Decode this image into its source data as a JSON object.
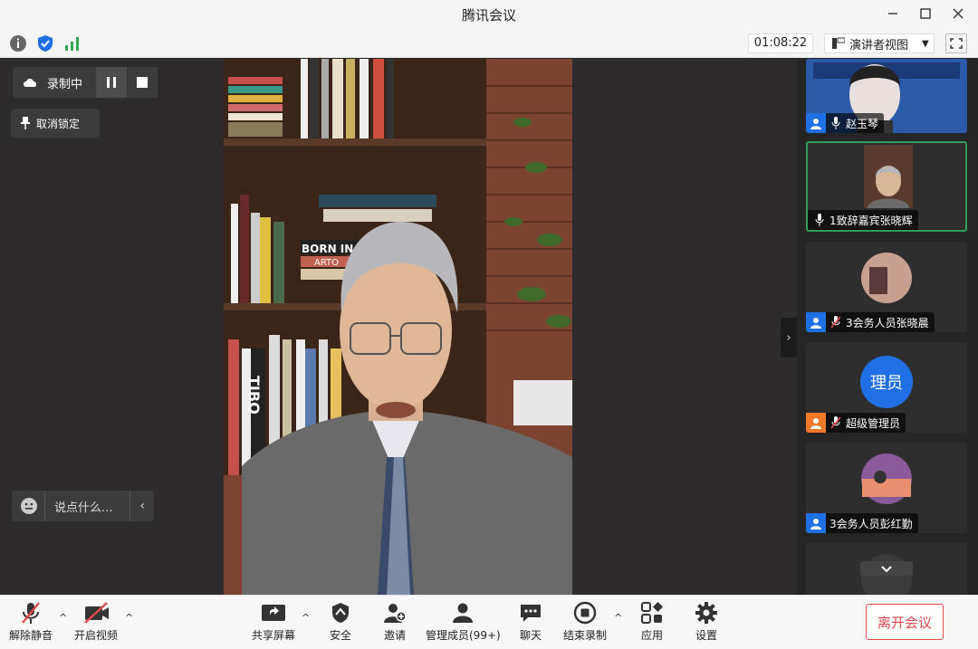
{
  "window": {
    "title": "腾讯会议"
  },
  "toolbar": {
    "timer": "01:08:22",
    "view_label": "演讲者视图"
  },
  "stage": {
    "recording_label": "录制中",
    "unlock_label": "取消锁定",
    "chat_placeholder": "说点什么...",
    "speaker_bg": {
      "book_text_1": "BORN IN T",
      "book_text_2": "ARTO",
      "book_text_3": "TIBO"
    }
  },
  "sidebar": {
    "participants": [
      {
        "name": "赵玉琴",
        "role": "member",
        "badge_color": "#1f6fe5"
      },
      {
        "name": "1致辞嘉宾张晓辉",
        "role": "none",
        "badge_color": ""
      },
      {
        "name": "3会务人员张晓晨",
        "role": "member",
        "badge_color": "#1f6fe5"
      },
      {
        "name": "超级管理员",
        "role": "host",
        "badge_color": "#f07a2a",
        "avatar_text": "理员"
      },
      {
        "name": "3会务人员彭红勤",
        "role": "member",
        "badge_color": "#1f6fe5"
      }
    ]
  },
  "bottom": {
    "unmute": "解除静音",
    "start_video": "开启视频",
    "share_screen": "共享屏幕",
    "security": "安全",
    "invite": "邀请",
    "manage_members": "管理成员(99+)",
    "chat": "聊天",
    "end_recording": "结束录制",
    "apps": "应用",
    "settings": "设置",
    "leave": "离开会议"
  }
}
